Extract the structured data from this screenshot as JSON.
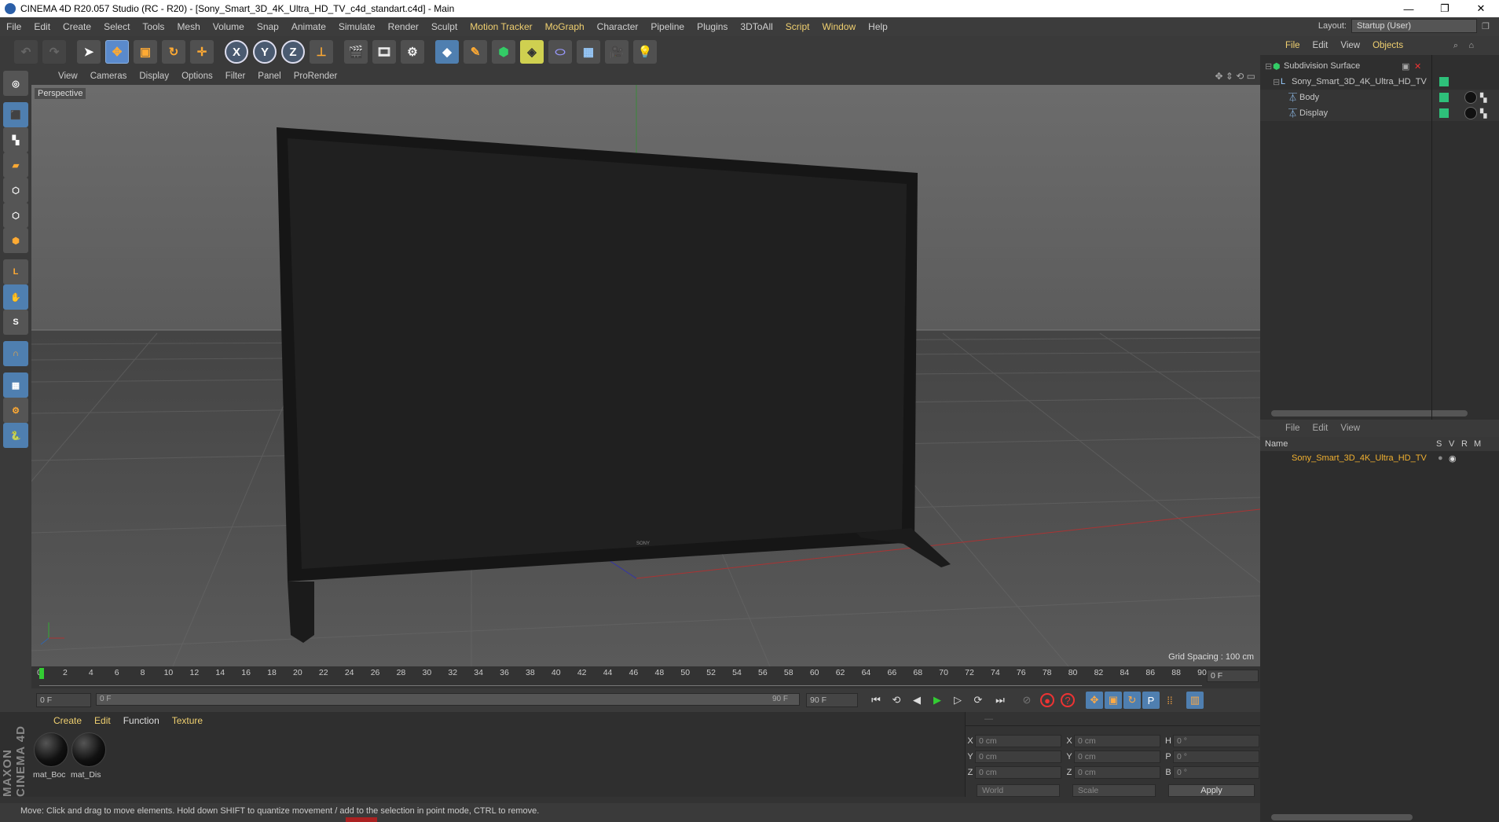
{
  "window": {
    "title": "CINEMA 4D R20.057 Studio (RC - R20) - [Sony_Smart_3D_4K_Ultra_HD_TV_c4d_standart.c4d] - Main",
    "controls": [
      "—",
      "❐",
      "✕"
    ]
  },
  "menubar": {
    "items": [
      "File",
      "Edit",
      "Create",
      "Select",
      "Tools",
      "Mesh",
      "Volume",
      "Snap",
      "Animate",
      "Simulate",
      "Render",
      "Sculpt",
      "Motion Tracker",
      "MoGraph",
      "Character",
      "Pipeline",
      "Plugins",
      "3DToAll",
      "Script",
      "Window",
      "Help"
    ],
    "highlighted": [
      "Motion Tracker",
      "MoGraph",
      "Script",
      "Window"
    ],
    "layout_label": "Layout:",
    "layout_value": "Startup (User)"
  },
  "viewport": {
    "menu": [
      "View",
      "Cameras",
      "Display",
      "Options",
      "Filter",
      "Panel",
      "ProRender"
    ],
    "camera_label": "Perspective",
    "grid_spacing": "Grid Spacing : 100 cm",
    "tv_brand": "SONY"
  },
  "timeline": {
    "ticks": [
      "0",
      "2",
      "4",
      "6",
      "8",
      "10",
      "12",
      "14",
      "16",
      "18",
      "20",
      "22",
      "24",
      "26",
      "28",
      "30",
      "32",
      "34",
      "36",
      "38",
      "40",
      "42",
      "44",
      "46",
      "48",
      "50",
      "52",
      "54",
      "56",
      "58",
      "60",
      "62",
      "64",
      "66",
      "68",
      "70",
      "72",
      "74",
      "76",
      "78",
      "80",
      "82",
      "84",
      "86",
      "88",
      "90"
    ],
    "current_frame": "0 F",
    "start_frame": "0 F",
    "slider_start": "0 F",
    "slider_end": "90 F",
    "end_frame": "90 F"
  },
  "materials": {
    "menu": [
      "Create",
      "Edit",
      "Function",
      "Texture"
    ],
    "items": [
      {
        "name": "mat_Boc"
      },
      {
        "name": "mat_Dis"
      }
    ],
    "brand": "MAXON CINEMA 4D"
  },
  "coordinates": {
    "rows": [
      {
        "a": "X",
        "av": "0 cm",
        "b": "X",
        "bv": "0 cm",
        "c": "H",
        "cv": "0 °"
      },
      {
        "a": "Y",
        "av": "0 cm",
        "b": "Y",
        "bv": "0 cm",
        "c": "P",
        "cv": "0 °"
      },
      {
        "a": "Z",
        "av": "0 cm",
        "b": "Z",
        "bv": "0 cm",
        "c": "B",
        "cv": "0 °"
      }
    ],
    "mode1": "World",
    "mode2": "Scale",
    "apply": "Apply"
  },
  "status": {
    "text": "Move: Click and drag to move elements. Hold down SHIFT to quantize movement / add to the selection in point mode, CTRL to remove."
  },
  "object_manager": {
    "menu": [
      "File",
      "Edit",
      "View",
      "Objects"
    ],
    "objects": [
      {
        "name": "Subdivision Surface"
      },
      {
        "name": "Sony_Smart_3D_4K_Ultra_HD_TV"
      },
      {
        "name": "Body"
      },
      {
        "name": "Display"
      }
    ]
  },
  "layer_manager": {
    "menu": [
      "File",
      "Edit",
      "View"
    ],
    "columns": [
      "Name",
      "S",
      "V",
      "R",
      "M"
    ],
    "rows": [
      {
        "name": "Sony_Smart_3D_4K_Ultra_HD_TV"
      }
    ]
  },
  "colors": {
    "accent": "#f0d070",
    "tag_green": "#2ec07a",
    "toolbar_blue": "#4f7fb0"
  }
}
